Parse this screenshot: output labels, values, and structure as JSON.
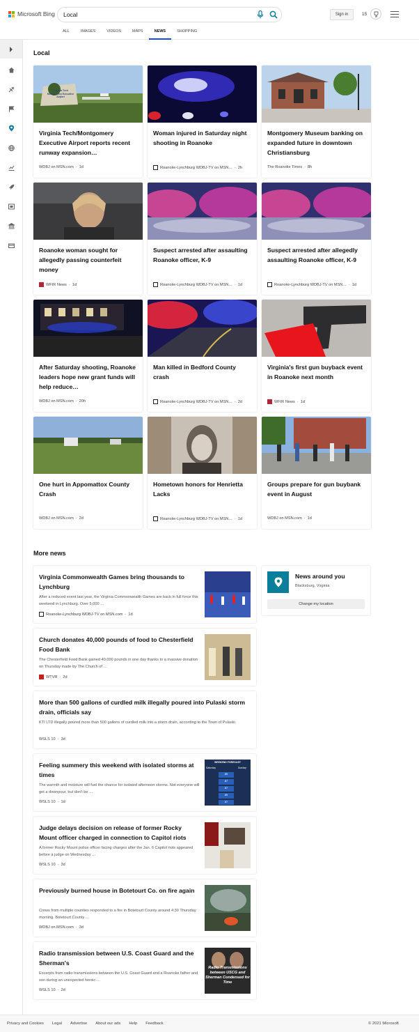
{
  "brand": {
    "name": "Microsoft Bing"
  },
  "search": {
    "query": "Local"
  },
  "header": {
    "signin_label": "Sign in",
    "rewards_count": "15"
  },
  "tabs": [
    "ALL",
    "IMAGES",
    "VIDEOS",
    "MAPS",
    "NEWS",
    "SHOPPING"
  ],
  "active_tab": "NEWS",
  "local": {
    "title": "Local",
    "cards": [
      {
        "title": "Virginia Tech/Montgomery Executive Airport reports recent runway expansion…",
        "source": "WDBJ on MSN.com",
        "age": "1d",
        "image_text": "Virginia Tech Montgomery Executive Airport"
      },
      {
        "title": "Woman injured in Saturday night shooting in Roanoke",
        "source": "Roanoke-Lynchburg WDBJ-TV on MSN…",
        "age": "2h"
      },
      {
        "title": "Montgomery Museum banking on expanded future in downtown Christiansburg",
        "source": "The Roanoke Times",
        "age": "8h"
      },
      {
        "title": "Roanoke woman sought for allegedly passing counterfeit money",
        "source": "WFIR News",
        "age": "1d"
      },
      {
        "title": "Suspect arrested after assaulting Roanoke officer, K-9",
        "source": "Roanoke-Lynchburg WDBJ-TV on MSN…",
        "age": "1d"
      },
      {
        "title": "Suspect arrested after allegedly assaulting Roanoke officer, K-9",
        "source": "Roanoke-Lynchburg WDBJ-TV on MSN…",
        "age": "1d"
      },
      {
        "title": "After Saturday shooting, Roanoke leaders hope new grant funds will help reduce…",
        "source": "WDBJ on MSN.com",
        "age": "20h"
      },
      {
        "title": "Man killed in Bedford County crash",
        "source": "Roanoke-Lynchburg WDBJ-TV on MSN…",
        "age": "2d"
      },
      {
        "title": "Virginia's first gun buyback event in Roanoke next month",
        "source": "WFIR News",
        "age": "1d"
      },
      {
        "title": "One hurt in Appomattox County Crash",
        "source": "WDBJ on MSN.com",
        "age": "2d"
      },
      {
        "title": "Hometown honors for Henrietta Lacks",
        "source": "Roanoke-Lynchburg WDBJ-TV on MSN…",
        "age": "1d"
      },
      {
        "title": "Groups prepare for gun buybank event in August",
        "source": "WDBJ on MSN.com",
        "age": "1d"
      }
    ]
  },
  "more_news": {
    "title": "More news",
    "items": [
      {
        "title": "Virginia Commonwealth Games bring thousands to Lynchburg",
        "snippet": "After a reduced event last year, the Virginia Commonwealth Games are back in full force this weekend in Lynchburg. Over 5,000 …",
        "source": "Roanoke-Lynchburg WDBJ-TV on MSN.com",
        "age": "1d"
      },
      {
        "title": "Church donates 40,000 pounds of food to Chesterfield Food Bank",
        "snippet": "The Chesterfield Food Bank gained 40,000 pounds in one day thanks to a massive donation on Thursday made by The Church of …",
        "source": "WTVR",
        "age": "2d"
      },
      {
        "title": "More than 500 gallons of curdled milk illegally poured into Pulaski storm drain, officials say",
        "snippet": "KTI LTD illegally poured more than 500 gallons of curdled milk into a storm drain, according to the Town of Pulaski.",
        "source": "WSLS 10",
        "age": "3d"
      },
      {
        "title": "Feeling summery this weekend with isolated storms at times",
        "snippet": "The warmth and moisture will fuel the chance for isolated afternoon storms. Not everyone will get a downpour, but don't be …",
        "source": "WSLS 10",
        "age": "1d",
        "thumb": {
          "header": "WEEKEND FORECAST",
          "sat": "Saturday",
          "sun": "Sunday",
          "rows": [
            "85",
            "87",
            "87",
            "85",
            "87"
          ]
        }
      },
      {
        "title": "Judge delays decision on release of former Rocky Mount officer charged in connection to Capitol riots",
        "snippet": "A former Rocky Mount police officer facing charges after the Jan. 6 Capitol riots appeared before a judge on Wednesday …",
        "source": "WSLS 10",
        "age": "3d"
      },
      {
        "title": "Previously burned house in Botetourt Co. on fire again",
        "snippet": "Crews from multiple counties responded to a fire in Botetourt County around 4:30 Thursday morning. Botetourt County …",
        "source": "WDBJ on MSN.com",
        "age": "3d"
      },
      {
        "title": "Radio transmission between U.S. Coast Guard and the Sherman's",
        "snippet": "Excerpts from radio transmissions between the U.S. Coast Guard and a Roanoke father and son during an unexpected heroic …",
        "source": "WSLS 10",
        "age": "2d",
        "thumb_text": "Radio Transmissions between USCG and Sherman Condensed for Time"
      }
    ]
  },
  "news_around": {
    "title": "News around you",
    "location": "Blacksburg, Virginia",
    "button": "Change my location"
  },
  "footer": {
    "links": [
      "Privacy and Cookies",
      "Legal",
      "Advertise",
      "About our ads",
      "Help",
      "Feedback"
    ],
    "copyright": "© 2021 Microsoft"
  },
  "colors": {
    "accent": "#174ae4",
    "pin": "#0b7e9c"
  }
}
